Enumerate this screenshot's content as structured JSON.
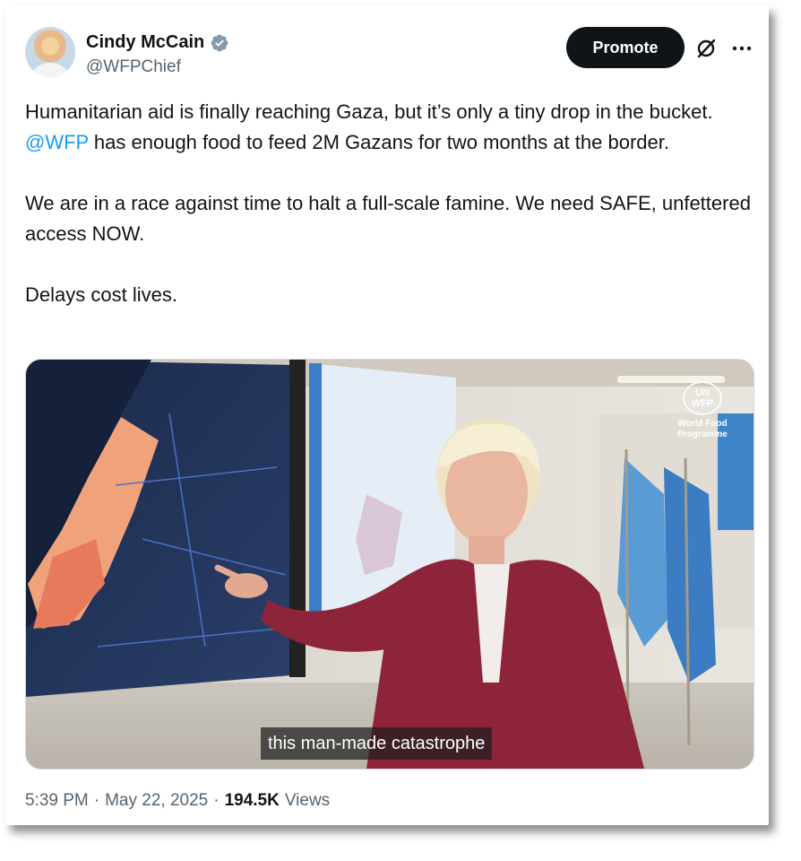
{
  "author": {
    "display_name": "Cindy McCain",
    "handle": "@WFPChief",
    "verified_icon": "verified-badge-icon"
  },
  "actions": {
    "promote_label": "Promote",
    "grok_icon": "grok-slash-icon",
    "more_icon": "more-dots-icon"
  },
  "tweet": {
    "line1_before": "Humanitarian aid is finally reaching Gaza, but it’s only a tiny drop in the bucket. ",
    "mention": "@WFP",
    "line1_after": " has enough food to feed 2M Gazans for two months at the border.",
    "paragraph2": "We are in a race against time to halt a full-scale famine. We need SAFE, unfettered access NOW.",
    "paragraph3": "Delays cost lives."
  },
  "media": {
    "subtitle": "this man-made catastrophe",
    "logo_top": "UN WFP",
    "logo_text": "World Food Programme"
  },
  "meta": {
    "time": "5:39 PM",
    "sep1": "·",
    "date": "May 22, 2025",
    "sep2": "·",
    "views_count": "194.5K",
    "views_label": "Views"
  },
  "colors": {
    "link": "#1d9bf0",
    "verified": "#829aab",
    "button_bg": "#0f1419",
    "text": "#0f1419",
    "muted": "#536471"
  }
}
